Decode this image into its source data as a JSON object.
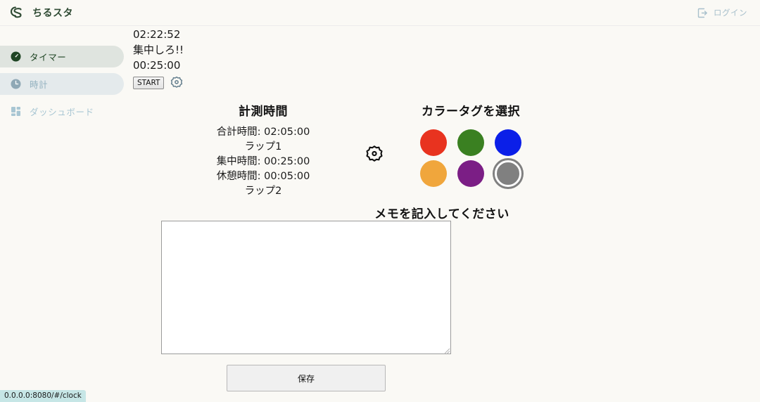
{
  "header": {
    "brand_name": "ちるスタ",
    "brand_logo_icon": "cs-logo-icon",
    "login_label": "ログイン",
    "login_icon": "login-arrow-icon",
    "brand_color": "#2e4a33"
  },
  "sidebar": {
    "items": [
      {
        "label": "タイマー",
        "icon": "timer-clock-icon",
        "state": "active"
      },
      {
        "label": "時計",
        "icon": "clock-icon",
        "state": "hover"
      },
      {
        "label": "ダッシュボード",
        "icon": "dashboard-grid-icon",
        "state": "plain"
      }
    ],
    "active_bg": "#dfe4df",
    "hover_bg": "#e4eaec",
    "active_text": "#1e4423",
    "muted_text": "#a8c6d3"
  },
  "timer": {
    "elapsed_total": "02:22:52",
    "message": "集中しろ!!",
    "countdown": "00:25:00",
    "start_label": "START",
    "settings_icon": "gear-icon"
  },
  "measure": {
    "title": "計測時間",
    "lines": [
      "合計時間: 02:05:00",
      "ラップ1",
      "集中時間: 00:25:00",
      "休憩時間: 00:05:00",
      "ラップ2"
    ],
    "settings_icon": "gear-icon"
  },
  "colortag": {
    "title": "カラータグを選択",
    "swatches": [
      {
        "name": "red",
        "color": "#e8331f",
        "selected": false
      },
      {
        "name": "green",
        "color": "#3a8021",
        "selected": false
      },
      {
        "name": "blue",
        "color": "#0b1fe8",
        "selected": false
      },
      {
        "name": "orange",
        "color": "#f0a63c",
        "selected": false
      },
      {
        "name": "purple",
        "color": "#7b1e85",
        "selected": false
      },
      {
        "name": "gray",
        "color": "#808080",
        "selected": true
      }
    ]
  },
  "memo": {
    "title": "メモを記入してください",
    "value": "",
    "placeholder": ""
  },
  "actions": {
    "save_label": "保存"
  },
  "statusbar": {
    "url": "0.0.0.0:8080/#/clock"
  }
}
